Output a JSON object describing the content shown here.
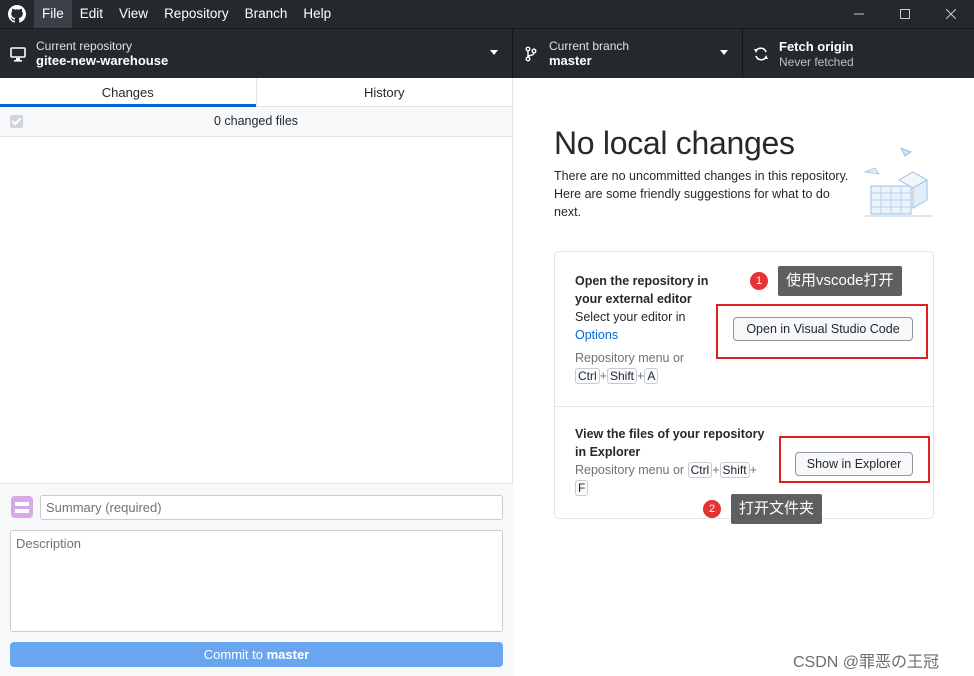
{
  "menu": [
    "File",
    "Edit",
    "View",
    "Repository",
    "Branch",
    "Help"
  ],
  "toolbar": {
    "repo_small": "Current repository",
    "repo_name": "gitee-new-warehouse",
    "branch_small": "Current branch",
    "branch_name": "master",
    "fetch_title": "Fetch origin",
    "fetch_sub": "Never fetched"
  },
  "tabs": {
    "changes": "Changes",
    "history": "History"
  },
  "changes": {
    "count_text": "0 changed files"
  },
  "commit": {
    "summary_placeholder": "Summary (required)",
    "description_placeholder": "Description",
    "button_prefix": "Commit to ",
    "button_branch": "master"
  },
  "main": {
    "heading": "No local changes",
    "subtext": "There are no uncommitted changes in this repository. Here are some friendly suggestions for what to do next."
  },
  "suggestions": {
    "editor": {
      "title_line1": "Open the repository in",
      "title_line2": "your external editor",
      "desc": "Select your editor in",
      "options_link": "Options",
      "menu_hint": "Repository menu or",
      "keys": [
        "Ctrl",
        "Shift",
        "A"
      ],
      "button": "Open in Visual Studio Code"
    },
    "explorer": {
      "title_line1": "View the files of your repository",
      "title_line2": "in Explorer",
      "menu_hint": "Repository menu or",
      "keys": [
        "Ctrl",
        "Shift",
        "F"
      ],
      "button": "Show in Explorer"
    }
  },
  "annotations": {
    "callout1": "使用vscode打开",
    "badge1": "1",
    "callout2": "打开文件夹",
    "badge2": "2"
  },
  "watermark": "CSDN @罪恶の王冠",
  "colors": {
    "accent": "#0366d6",
    "dark": "#24292e",
    "commit_button": "#6aa6ef",
    "annotation_red": "#e02020"
  }
}
